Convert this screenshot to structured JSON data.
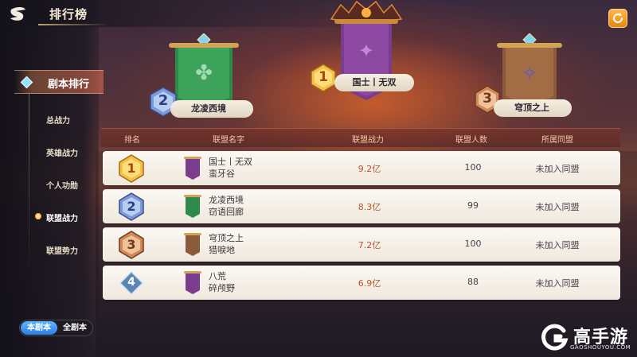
{
  "header": {
    "title": "排行榜",
    "back_icon": "back-swirl-icon",
    "refresh_icon": "refresh-icon"
  },
  "sidebar": {
    "main_item": "剧本排行",
    "sub_items": [
      {
        "label": "总战力",
        "active": false
      },
      {
        "label": "英雄战力",
        "active": false
      },
      {
        "label": "个人功勋",
        "active": false
      },
      {
        "label": "联盟战力",
        "active": true
      },
      {
        "label": "联盟势力",
        "active": false
      }
    ],
    "scope_toggle": {
      "current": "本剧本",
      "all": "全剧本"
    }
  },
  "podium": {
    "first": {
      "rank": "1",
      "name": "国士丨无双",
      "banner_color": "#7a3c8c"
    },
    "second": {
      "rank": "2",
      "name": "龙凌西境",
      "banner_color": "#2e8a4a"
    },
    "third": {
      "rank": "3",
      "name": "穹顶之上",
      "banner_color": "#8a5a3a"
    }
  },
  "table": {
    "headers": [
      "排名",
      "联盟名字",
      "联盟战力",
      "联盟人数",
      "所属同盟"
    ],
    "rows": [
      {
        "rank": "1",
        "name": "国士丨无双",
        "server": "蛮牙谷",
        "power": "9.2亿",
        "members": "100",
        "alliance": "未加入同盟",
        "flag_color": "#7a3c8c"
      },
      {
        "rank": "2",
        "name": "龙凌西境",
        "server": "窃语回廊",
        "power": "8.3亿",
        "members": "99",
        "alliance": "未加入同盟",
        "flag_color": "#2e8a4a"
      },
      {
        "rank": "3",
        "name": "穹顶之上",
        "server": "猎唳地",
        "power": "7.2亿",
        "members": "100",
        "alliance": "未加入同盟",
        "flag_color": "#8a5a3a"
      },
      {
        "rank": "4",
        "name": "八荒",
        "server": "碎颅野",
        "power": "6.9亿",
        "members": "88",
        "alliance": "未加入同盟",
        "flag_color": "#7a3c8c"
      }
    ]
  },
  "watermark": {
    "brand": "高手游",
    "url": "GAOSHOUYOU.COM"
  }
}
